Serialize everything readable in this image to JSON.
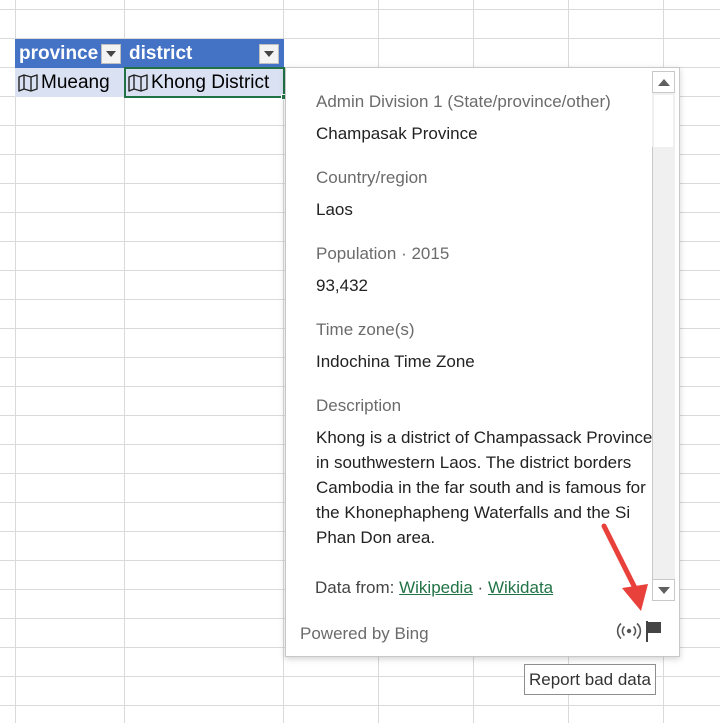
{
  "table": {
    "headers": [
      "province",
      "district"
    ],
    "row": [
      "Mueang",
      "Khong District"
    ]
  },
  "card": {
    "fields": [
      {
        "label": "Admin Division 1 (State/province/other)",
        "value": "Champasak Province"
      },
      {
        "label": "Country/region",
        "value": "Laos"
      },
      {
        "label": "Population · 2015",
        "value": "93,432"
      },
      {
        "label": "Time zone(s)",
        "value": "Indochina Time Zone"
      }
    ],
    "description": {
      "label": "Description",
      "value": "Khong is a district of Champassack Province in southwestern Laos. The district borders Cambodia in the far south and is famous for the Khonephapheng Waterfalls and the Si Phan Don area."
    },
    "data_from_label": "Data from:",
    "source_1": "Wikipedia",
    "source_sep": "·",
    "source_2": "Wikidata",
    "powered_by": "Powered by Bing"
  },
  "tooltip": "Report bad data",
  "colors": {
    "header_bg": "#4472c4",
    "row_bg": "#d9e1f2",
    "link": "#217346",
    "arrow": "#e8403a"
  },
  "icons": [
    "map-icon",
    "filter-dropdown-icon",
    "live-data-icon",
    "flag-icon",
    "scroll-up-icon",
    "scroll-down-icon"
  ]
}
